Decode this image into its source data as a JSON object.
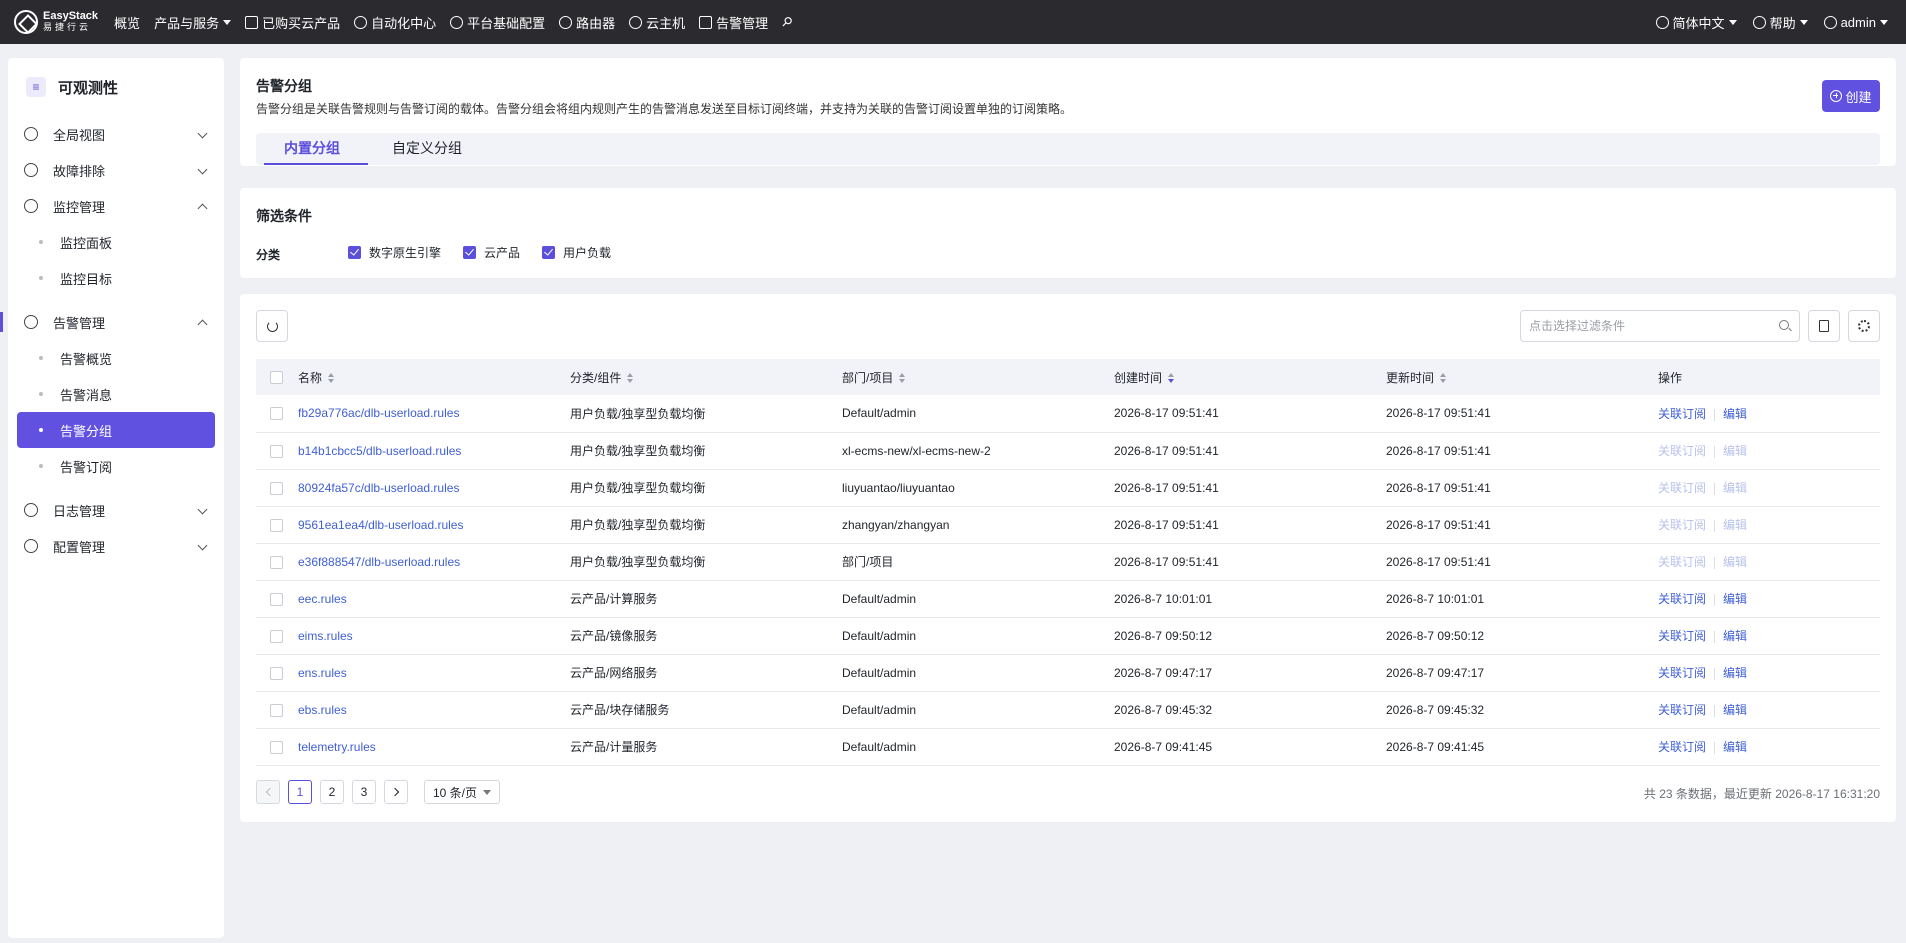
{
  "topbar": {
    "logo_l1": "EasyStack",
    "logo_l2": "易捷行云",
    "nav": [
      {
        "label": "概览",
        "icon": "none"
      },
      {
        "label": "产品与服务",
        "icon": "none",
        "dropdown": true
      },
      {
        "label": "已购买云产品",
        "icon": "cart-icon"
      },
      {
        "label": "自动化中心",
        "icon": "automation-icon"
      },
      {
        "label": "平台基础配置",
        "icon": "gear-icon"
      },
      {
        "label": "路由器",
        "icon": "router-icon"
      },
      {
        "label": "云主机",
        "icon": "cloud-icon"
      },
      {
        "label": "告警管理",
        "icon": "alarm-icon"
      }
    ],
    "language": "简体中文",
    "help": "帮助",
    "user": "admin"
  },
  "sidebar": {
    "title": "可观测性",
    "groups": [
      {
        "label": "全局视图",
        "expanded": false,
        "children": []
      },
      {
        "label": "故障排除",
        "expanded": false,
        "children": []
      },
      {
        "label": "监控管理",
        "expanded": true,
        "children": [
          "监控面板",
          "监控目标"
        ]
      },
      {
        "label": "告警管理",
        "expanded": true,
        "children": [
          "告警概览",
          "告警消息",
          "告警分组",
          "告警订阅"
        ]
      },
      {
        "label": "日志管理",
        "expanded": false,
        "children": []
      },
      {
        "label": "配置管理",
        "expanded": false,
        "children": []
      }
    ],
    "active_child": "告警分组"
  },
  "header": {
    "title": "告警分组",
    "description": "告警分组是关联告警规则与告警订阅的载体。告警分组会将组内规则产生的告警消息发送至目标订阅终端，并支持为关联的告警订阅设置单独的订阅策略。",
    "create_label": "创建",
    "tabs": [
      "内置分组",
      "自定义分组"
    ],
    "active_tab": "内置分组"
  },
  "filter": {
    "title": "筛选条件",
    "label": "分类",
    "options": [
      {
        "label": "数字原生引擎",
        "checked": true
      },
      {
        "label": "云产品",
        "checked": true
      },
      {
        "label": "用户负载",
        "checked": true
      }
    ]
  },
  "table": {
    "search_placeholder": "点击选择过滤条件",
    "columns": [
      "名称",
      "分类/组件",
      "部门/项目",
      "创建时间",
      "更新时间",
      "操作"
    ],
    "sorted_column": "创建时间",
    "actions": [
      "关联订阅",
      "编辑"
    ],
    "rows": [
      {
        "name": "fb29a776ac/dlb-userload.rules",
        "category": "用户负载/独享型负载均衡",
        "project": "Default/admin",
        "created": "2026-8-17 09:51:41",
        "updated": "2026-8-17 09:51:41",
        "enabled": true
      },
      {
        "name": "b14b1cbcc5/dlb-userload.rules",
        "category": "用户负载/独享型负载均衡",
        "project": "xl-ecms-new/xl-ecms-new-2",
        "created": "2026-8-17 09:51:41",
        "updated": "2026-8-17 09:51:41",
        "enabled": false
      },
      {
        "name": "80924fa57c/dlb-userload.rules",
        "category": "用户负载/独享型负载均衡",
        "project": "liuyuantao/liuyuantao",
        "created": "2026-8-17 09:51:41",
        "updated": "2026-8-17 09:51:41",
        "enabled": false
      },
      {
        "name": "9561ea1ea4/dlb-userload.rules",
        "category": "用户负载/独享型负载均衡",
        "project": "zhangyan/zhangyan",
        "created": "2026-8-17 09:51:41",
        "updated": "2026-8-17 09:51:41",
        "enabled": false
      },
      {
        "name": "e36f888547/dlb-userload.rules",
        "category": "用户负载/独享型负载均衡",
        "project": "部门/项目",
        "created": "2026-8-17 09:51:41",
        "updated": "2026-8-17 09:51:41",
        "enabled": false
      },
      {
        "name": "eec.rules",
        "category": "云产品/计算服务",
        "project": "Default/admin",
        "created": "2026-8-7 10:01:01",
        "updated": "2026-8-7 10:01:01",
        "enabled": true
      },
      {
        "name": "eims.rules",
        "category": "云产品/镜像服务",
        "project": "Default/admin",
        "created": "2026-8-7 09:50:12",
        "updated": "2026-8-7 09:50:12",
        "enabled": true
      },
      {
        "name": "ens.rules",
        "category": "云产品/网络服务",
        "project": "Default/admin",
        "created": "2026-8-7 09:47:17",
        "updated": "2026-8-7 09:47:17",
        "enabled": true
      },
      {
        "name": "ebs.rules",
        "category": "云产品/块存储服务",
        "project": "Default/admin",
        "created": "2026-8-7 09:45:32",
        "updated": "2026-8-7 09:45:32",
        "enabled": true
      },
      {
        "name": "telemetry.rules",
        "category": "云产品/计量服务",
        "project": "Default/admin",
        "created": "2026-8-7 09:41:45",
        "updated": "2026-8-7 09:41:45",
        "enabled": true
      }
    ]
  },
  "pagination": {
    "pages": [
      "1",
      "2",
      "3"
    ],
    "current": "1",
    "page_size": "10 条/页",
    "summary": "共 23 条数据，最近更新 2026-8-17 16:31:20"
  }
}
